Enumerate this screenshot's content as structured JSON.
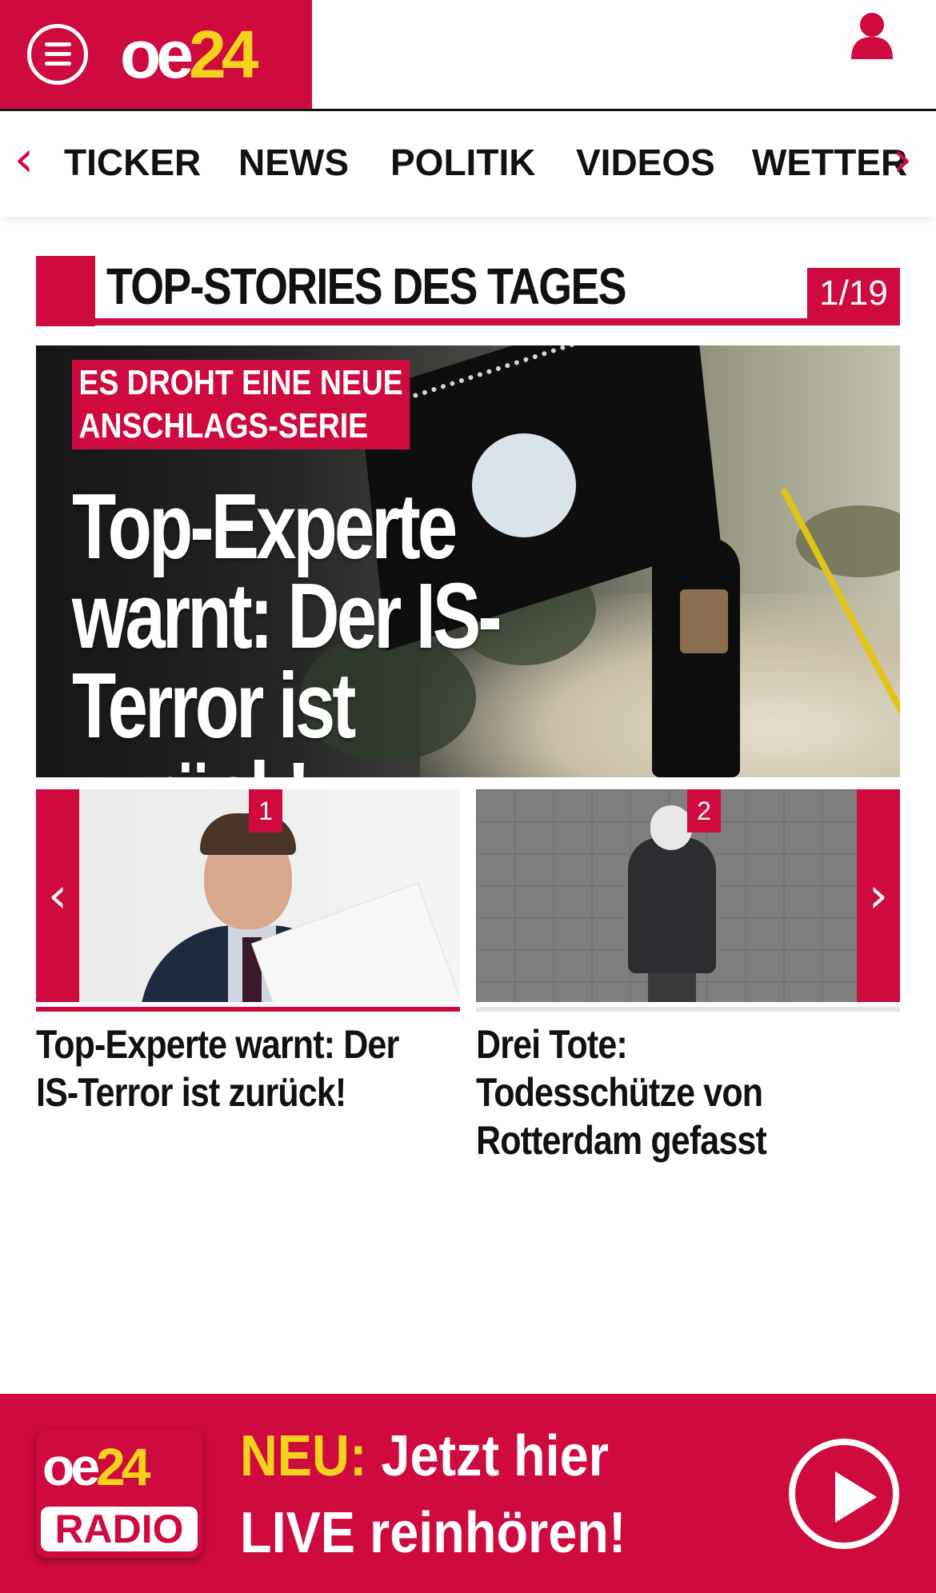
{
  "header": {
    "logo_oe": "oe",
    "logo_num": "24",
    "brand_color": "#cf0a3e",
    "accent_color": "#f5d21b",
    "menu_icon": "hamburger-menu-icon",
    "user_icon": "user-icon"
  },
  "nav": {
    "prev_arrow": "‹",
    "next_arrow": "›",
    "items": [
      "TICKER",
      "NEWS",
      "POLITIK",
      "VIDEOS",
      "WETTER"
    ]
  },
  "section": {
    "title": "TOP-STORIES DES TAGES",
    "counter": "1/19"
  },
  "hero": {
    "kicker_line1": "ES DROHT EINE NEUE",
    "kicker_line2": "ANSCHLAGS-SERIE",
    "title": "Top-Experte warnt: Der IS-Terror ist zurück!"
  },
  "slider": {
    "prev": "‹",
    "next": "›",
    "items": [
      {
        "number": "1",
        "caption": "Top-Experte warnt: Der IS-Terror ist zurück!"
      },
      {
        "number": "2",
        "caption": "Drei Tote: Todesschütze von Rotterdam gefasst"
      }
    ]
  },
  "radio": {
    "logo_oe": "oe",
    "logo_num": "24",
    "logo_label": "RADIO",
    "neu": "NEU:",
    "line1_rest": " Jetzt hier",
    "line2": "LIVE reinhören!",
    "play_icon": "play-icon"
  }
}
